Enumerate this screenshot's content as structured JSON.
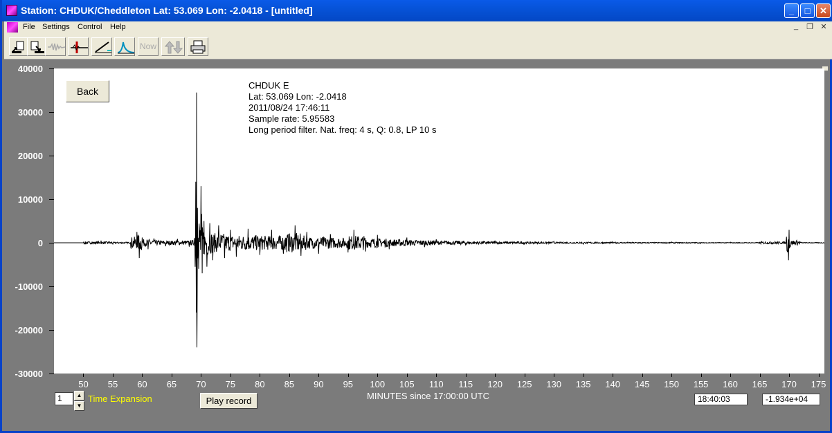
{
  "window": {
    "title": "Station: CHDUK/Cheddleton Lat: 53.069 Lon: -2.0418 - [untitled]",
    "controls": {
      "minimize": "_",
      "maximize": "□",
      "close": "✕"
    }
  },
  "menubar": {
    "items": [
      "File",
      "Settings",
      "Control",
      "Help"
    ],
    "mdi_controls": {
      "minimize": "_",
      "restore": "❐",
      "close": "✕"
    }
  },
  "toolbar": {
    "tools": [
      {
        "name": "open-file-icon"
      },
      {
        "name": "save-file-icon"
      },
      {
        "name": "waveform-icon",
        "disabled": true
      },
      {
        "name": "pick-marker-icon"
      },
      {
        "name": "filter-ramp-icon"
      },
      {
        "name": "spectrum-peak-icon"
      },
      {
        "name": "now-button",
        "label": "Now",
        "disabled": true
      },
      {
        "name": "up-down-arrows-icon",
        "disabled": true
      },
      {
        "name": "print-icon"
      }
    ]
  },
  "buttons": {
    "back": "Back",
    "play_record": "Play record"
  },
  "info": {
    "station": "CHDUK  E",
    "location": "Lat: 53.069 Lon: -2.0418",
    "datetime": "2011/08/24 17:46:11",
    "sample_rate": "Sample rate: 5.95583",
    "filter": "Long period filter. Nat. freq: 4 s, Q: 0.8, LP 10 s"
  },
  "controls": {
    "time_expansion_value": "1",
    "time_expansion_label": "Time Expansion",
    "time_readout": "18:40:03",
    "value_readout": "-1.934e+04"
  },
  "chart_data": {
    "type": "line",
    "title": "",
    "xlabel": "MINUTES since 17:00:00 UTC",
    "ylabel": "",
    "xlim": [
      45,
      176
    ],
    "ylim": [
      -30000,
      40000
    ],
    "yticks": [
      40000,
      30000,
      20000,
      10000,
      0,
      -10000,
      -20000,
      -30000
    ],
    "ytick_labels": [
      "40000",
      "30000",
      "20000",
      "10000",
      "0",
      "-10000",
      "-20000",
      "-30000"
    ],
    "xticks": [
      50,
      55,
      60,
      65,
      70,
      75,
      80,
      85,
      90,
      95,
      100,
      105,
      110,
      115,
      120,
      125,
      130,
      135,
      140,
      145,
      150,
      155,
      160,
      165,
      170,
      175
    ],
    "series": [
      {
        "x": [
          45,
          50,
          53,
          55,
          58,
          59.1,
          59.5,
          60,
          61,
          62,
          64,
          66,
          68,
          68.9,
          69.1,
          69.2,
          69.25,
          69.3,
          69.4,
          69.6,
          70,
          70.2,
          70.5,
          71,
          71.5,
          72,
          73,
          74,
          75,
          76,
          78,
          80,
          82,
          84,
          86,
          87,
          88,
          90,
          92,
          95,
          96,
          98,
          100,
          102,
          105,
          108,
          110,
          115,
          120,
          125,
          130,
          135,
          140,
          145,
          150,
          155,
          160,
          165,
          169.5,
          169.9,
          170,
          170.2,
          172,
          176
        ],
        "y": [
          0,
          0,
          500,
          -300,
          0,
          2500,
          -3500,
          1200,
          -1500,
          1000,
          -800,
          900,
          -900,
          1000,
          14000,
          -16000,
          34500,
          -24000,
          8000,
          -6000,
          13000,
          -7000,
          5000,
          -5500,
          4500,
          -4000,
          4000,
          -3500,
          3000,
          -3200,
          3200,
          -2800,
          3000,
          -2500,
          4000,
          -3000,
          2500,
          -2500,
          2000,
          -2200,
          3000,
          -2000,
          1800,
          -1500,
          1200,
          -1000,
          800,
          -600,
          500,
          -400,
          300,
          -300,
          250,
          -200,
          200,
          -150,
          150,
          -100,
          500,
          -4000,
          3000,
          -1000,
          150,
          0
        ]
      }
    ]
  }
}
